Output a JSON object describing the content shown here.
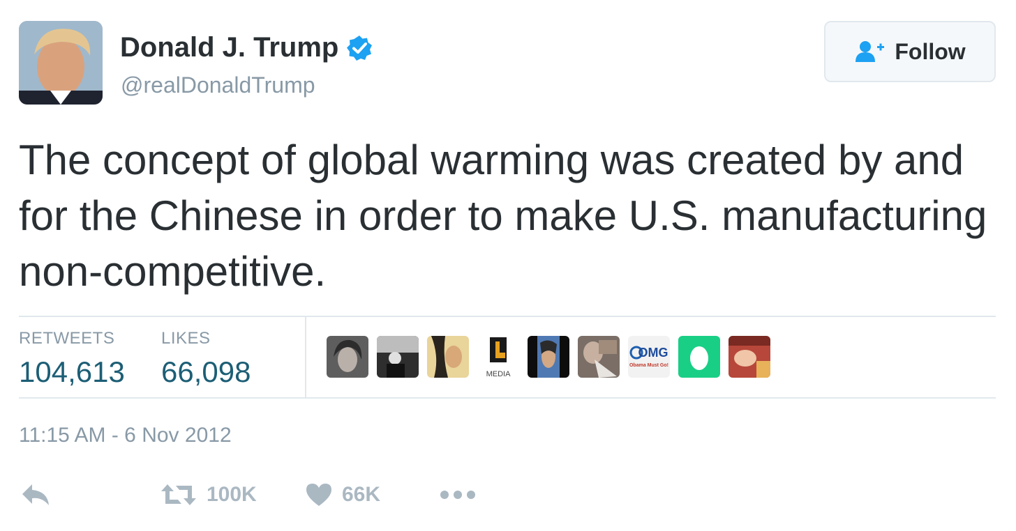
{
  "author": {
    "name": "Donald J. Trump",
    "handle": "@realDonaldTrump",
    "verified_icon": "verified-badge-icon"
  },
  "follow_button": {
    "label": "Follow",
    "icon": "add-user-icon"
  },
  "tweet": {
    "text": "The concept of global warming was created by and for the Chinese in order to make U.S. manufacturing non-competitive.",
    "timestamp": "11:15 AM - 6 Nov 2012"
  },
  "stats": {
    "retweets_label": "RETWEETS",
    "retweets_value": "104,613",
    "likes_label": "LIKES",
    "likes_value": "66,098"
  },
  "likers": [
    {
      "name": "liker-avatar-1",
      "bg": "#6b6b6b"
    },
    {
      "name": "liker-avatar-2",
      "bg": "#3a3a3a"
    },
    {
      "name": "liker-avatar-3",
      "bg": "#caa55a"
    },
    {
      "name": "liker-avatar-4",
      "bg": "#ffffff",
      "text_main": "b",
      "text_sub": "MEDIA"
    },
    {
      "name": "liker-avatar-5",
      "bg": "#2a3f6a"
    },
    {
      "name": "liker-avatar-6",
      "bg": "#8a7a70"
    },
    {
      "name": "liker-avatar-7",
      "bg": "#f2f2f2",
      "text_main": "OMG",
      "text_sub": "Obama Must Go!"
    },
    {
      "name": "liker-avatar-8",
      "bg": "#19cf86"
    },
    {
      "name": "liker-avatar-9",
      "bg": "#c4574a"
    }
  ],
  "actions": {
    "reply_icon": "reply-icon",
    "retweet_icon": "retweet-icon",
    "retweet_count": "100K",
    "like_icon": "heart-icon",
    "like_count": "66K",
    "more_icon": "more-dots-icon"
  },
  "colors": {
    "text": "#292f33",
    "muted": "#8899a6",
    "stat_value": "#1c5e75",
    "verified": "#1da1f2",
    "action_gray": "#aab8c2"
  }
}
